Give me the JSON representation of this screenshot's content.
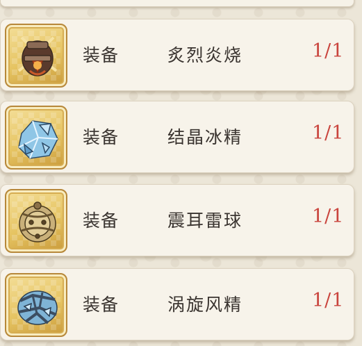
{
  "items": [
    {
      "type_label": "装备",
      "name": "炙烈炎烧",
      "count": "1/1",
      "icon": "fire-bomb-icon"
    },
    {
      "type_label": "装备",
      "name": "结晶冰精",
      "count": "1/1",
      "icon": "ice-crystal-icon"
    },
    {
      "type_label": "装备",
      "name": "震耳雷球",
      "count": "1/1",
      "icon": "thunder-orb-icon"
    },
    {
      "type_label": "装备",
      "name": "涡旋风精",
      "count": "1/1",
      "icon": "wind-crystal-icon"
    }
  ],
  "colors": {
    "count_text": "#c9433c",
    "label_text": "#3a3430",
    "frame_gold": "#e6c462",
    "row_bg": "#f7f3ea"
  }
}
